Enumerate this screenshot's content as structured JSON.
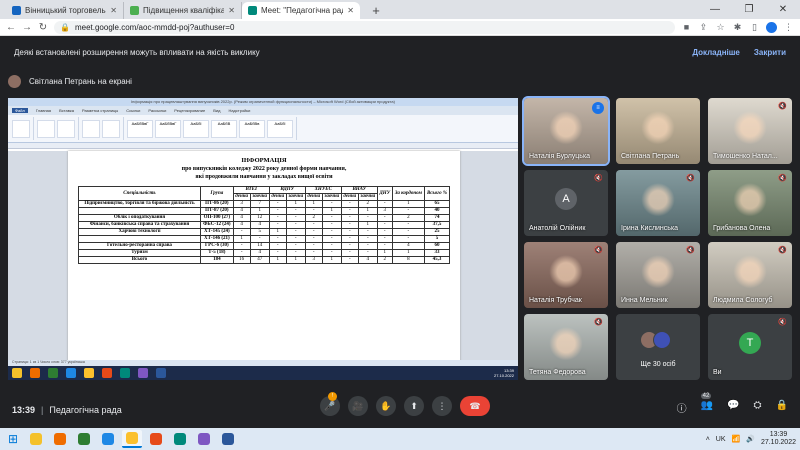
{
  "browser": {
    "tabs": [
      {
        "label": "Вінницький торговельно-економ",
        "color": "#1565c0",
        "active": false
      },
      {
        "label": "Підвищення кваліфікації",
        "color": "#4caf50",
        "active": false
      },
      {
        "label": "Meet: \"Педагогічна рада \"",
        "color": "#00897b",
        "active": true
      }
    ],
    "new_tab": "+",
    "window_controls": [
      "—",
      "❐",
      "✕"
    ],
    "url": "meet.google.com/aoc-mmdd-poj?authuser=0"
  },
  "warning": {
    "text": "Деякі встановлені розширення можуть впливати на якість виклику",
    "details": "Докладніше",
    "close": "Закрити"
  },
  "presenter": {
    "label": "Світлана Петрань на екрані"
  },
  "word": {
    "title": "Інформація про працевлаштування випускників 2022р. (Режим ограниченной функциональности) – Microsoft Word (Сбой активации продукта)",
    "tabs": [
      "Файл",
      "Главная",
      "Вставка",
      "Разметка страницы",
      "Ссылки",
      "Рассылки",
      "Рецензирование",
      "Вид",
      "Надстройки"
    ],
    "styles": [
      "АаБбВвГ",
      "АаБбВвГ",
      "АаБбІ",
      "АаБбВ",
      "АаБбВв",
      "АаБбІ"
    ],
    "doc_title": "ІНФОРМАЦІЯ",
    "doc_line1": "про випускників коледжу 2022 року денної форми навчання,",
    "doc_line2": "які продовжили навчання у закладах вищої освіти",
    "status": "Страница: 1 из 1   Число слов: 377   українська",
    "clock_time": "13:39",
    "clock_date": "27.10.2022",
    "lang": "UK"
  },
  "table": {
    "h_spec": "Спеціальність",
    "h_group": "Група",
    "h_universities": [
      "ВТЕІ",
      "ВДПУ",
      "ХНУЕС",
      "ВНАУ"
    ],
    "h_dnu": "ДНУ",
    "h_abroad": "За кордоном",
    "h_total": "Всього %",
    "h_forms": [
      "денна",
      "заочна"
    ],
    "rows": [
      {
        "spec": "Підприємництво, торгівля та біржова діяльність",
        "group": "ПТ-86 (20)",
        "v": [
          "3",
          "7",
          "-",
          "1",
          "1",
          "-",
          "-",
          "2",
          "-",
          "1"
        ],
        "total": "65"
      },
      {
        "spec": "",
        "group": "ПТ-87 (20)",
        "v": [
          "4",
          "1",
          "-",
          "-",
          "-",
          "1",
          "-",
          "1",
          "3",
          "-"
        ],
        "total": "40"
      },
      {
        "spec": "Облік і оподаткування",
        "group": "ОП-100 (27)",
        "v": [
          "4",
          "12",
          "-",
          "-",
          "2",
          "-",
          "-",
          "-",
          "-",
          "2"
        ],
        "total": "74"
      },
      {
        "spec": "Фінанси, банківська справа та страхування",
        "group": "ФБС-12 (24)",
        "v": [
          "4",
          "4",
          "-",
          "-",
          "-",
          "-",
          "-",
          "1",
          "-",
          "-"
        ],
        "total": "37,5"
      },
      {
        "spec": "Харчові технології",
        "group": "ХТ-145 (24)",
        "v": [
          "-",
          "5",
          "1",
          "-",
          "-",
          "-",
          "-",
          "-",
          "-",
          "-"
        ],
        "total": "25"
      },
      {
        "spec": "",
        "group": "ХТ-146 (21)",
        "v": [
          "1",
          "-",
          "-",
          "-",
          "-",
          "-",
          "-",
          "-",
          "-",
          "-"
        ],
        "total": "5"
      },
      {
        "spec": "Готельно-ресторанна справа",
        "group": "ГРС-6 (30)",
        "v": [
          "-",
          "14",
          "-",
          "-",
          "-",
          "-",
          "-",
          "-",
          "-",
          "4"
        ],
        "total": "60"
      },
      {
        "spec": "Туризм",
        "group": "Т-5 (18)",
        "v": [
          "-",
          "4",
          "-",
          "-",
          "-",
          "-",
          "-",
          "-",
          "1",
          "1"
        ],
        "total": "33"
      },
      {
        "spec": "Всього",
        "group": "184",
        "v": [
          "16",
          "47",
          "1",
          "1",
          "3",
          "1",
          "-",
          "4",
          "2",
          "8"
        ],
        "total": "45,3"
      }
    ]
  },
  "participants": [
    {
      "name": "Наталія Бурлуцька",
      "mic": "",
      "letter": "",
      "bg": "#b9a99a",
      "speaking": true
    },
    {
      "name": "Світлана Петрань",
      "mic": "",
      "letter": "",
      "bg": "#c8b79a",
      "speaking": false
    },
    {
      "name": "Тимошенко Натал...",
      "mic": "🔇",
      "letter": "",
      "bg": "#d9d3c7",
      "speaking": false
    },
    {
      "name": "Анатолій Олійник",
      "mic": "🔇",
      "letter": "A",
      "bg": "#3c4043",
      "letter_bg": "#5f6368",
      "speaking": false
    },
    {
      "name": "Ірина Кислинська",
      "mic": "🔇",
      "letter": "",
      "bg": "#6f8a8f",
      "speaking": false
    },
    {
      "name": "Грибанова Олена",
      "mic": "🔇",
      "letter": "",
      "bg": "#7b8c73",
      "speaking": false
    },
    {
      "name": "Наталія Трубчак",
      "mic": "🔇",
      "letter": "",
      "bg": "#8d6b5f",
      "speaking": false
    },
    {
      "name": "Инна Мельник",
      "mic": "🔇",
      "letter": "",
      "bg": "#a4a19a",
      "speaking": false
    },
    {
      "name": "Людмила Сологуб",
      "mic": "🔇",
      "letter": "",
      "bg": "#c9c3b6",
      "speaking": false
    },
    {
      "name": "Тетяна Федорова",
      "mic": "🔇",
      "letter": "",
      "bg": "#b0b7b4",
      "speaking": false
    },
    {
      "name": "Ще 30 осіб",
      "mic": "",
      "letter": "",
      "bg": "#3c4043",
      "speaking": false,
      "more": true
    },
    {
      "name": "Ви",
      "mic": "🔇",
      "letter": "Т",
      "bg": "#3c4043",
      "letter_bg": "#34a853",
      "speaking": false
    }
  ],
  "bottom": {
    "time": "13:39",
    "meeting_name": "Педагогічна рада",
    "mic_badge": "!",
    "participants_count": "42"
  },
  "taskbar": {
    "lang": "UK",
    "time": "13:39",
    "date": "27.10.2022",
    "apps": [
      {
        "color": "#f4c12b"
      },
      {
        "color": "#ef6c00"
      },
      {
        "color": "#2e7d32"
      },
      {
        "color": "#1e88e5"
      },
      {
        "color": "#fbc02d",
        "active": true
      },
      {
        "color": "#e64a19"
      },
      {
        "color": "#00897b"
      },
      {
        "color": "#7e57c2"
      },
      {
        "color": "#2b579a"
      }
    ]
  }
}
